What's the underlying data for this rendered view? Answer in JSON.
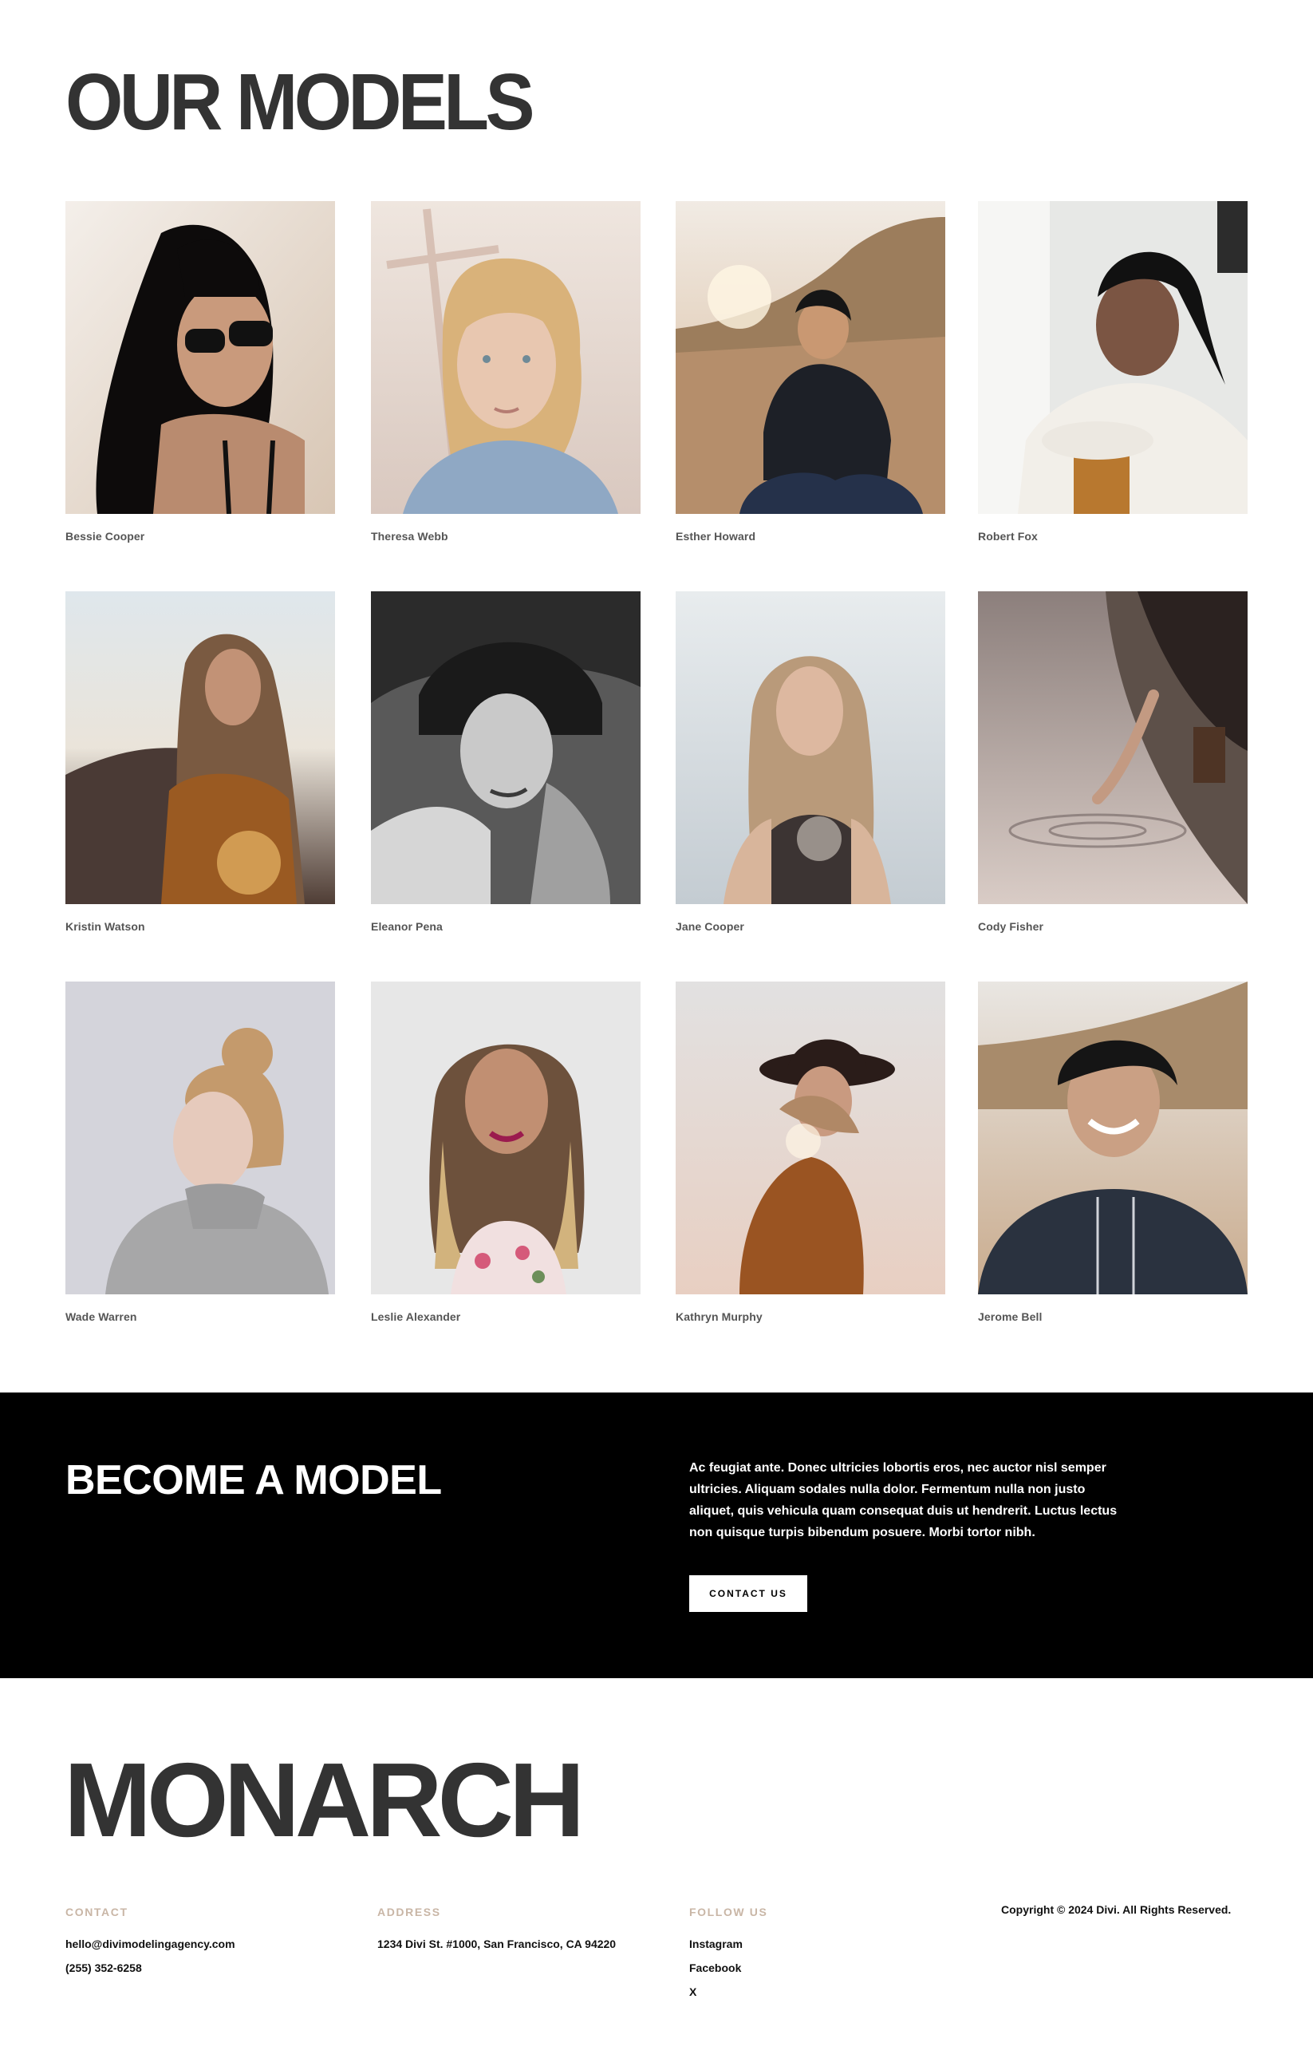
{
  "models": {
    "title": "OUR MODELS",
    "items": [
      {
        "name": "Bessie Cooper"
      },
      {
        "name": "Theresa Webb"
      },
      {
        "name": "Esther Howard"
      },
      {
        "name": "Robert Fox"
      },
      {
        "name": "Kristin Watson"
      },
      {
        "name": "Eleanor Pena"
      },
      {
        "name": "Jane Cooper"
      },
      {
        "name": "Cody Fisher"
      },
      {
        "name": "Wade Warren"
      },
      {
        "name": "Leslie Alexander"
      },
      {
        "name": "Kathryn Murphy"
      },
      {
        "name": "Jerome Bell"
      }
    ]
  },
  "cta": {
    "title": "BECOME A MODEL",
    "body": "Ac feugiat ante. Donec ultricies lobortis eros, nec auctor nisl semper ultricies. Aliquam sodales nulla dolor. Fermentum nulla non justo aliquet, quis vehicula quam consequat duis ut hendrerit. Luctus lectus non quisque turpis bibendum posuere. Morbi tortor nibh.",
    "button_label": "CONTACT US"
  },
  "footer": {
    "brand": "MONARCH",
    "contact": {
      "heading": "CONTACT",
      "email": "hello@divimodelingagency.com",
      "phone": "(255) 352-6258"
    },
    "address": {
      "heading": "ADDRESS",
      "line": "1234 Divi St. #1000, San Francisco, CA 94220"
    },
    "follow": {
      "heading": "FOLLOW US",
      "links": [
        "Instagram",
        "Facebook",
        "X"
      ]
    },
    "copyright": "Copyright © 2024 Divi. All Rights Reserved."
  }
}
